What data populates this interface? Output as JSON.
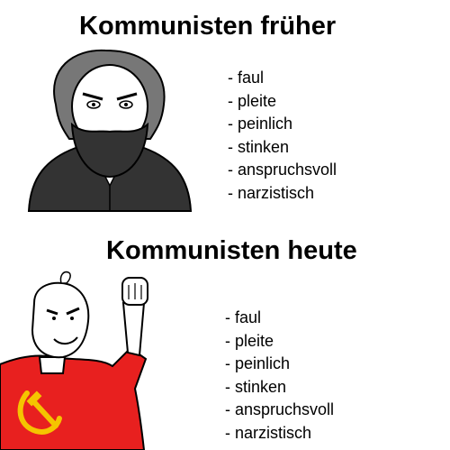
{
  "top_panel": {
    "title": "Kommunisten früher",
    "items": [
      "- faul",
      "- pleite",
      "- peinlich",
      "- stinken",
      "- anspruchsvoll",
      "- narzistisch"
    ]
  },
  "bottom_panel": {
    "title": "Kommunisten heute",
    "items": [
      "- faul",
      "- pleite",
      "- peinlich",
      "- stinken",
      "- anspruchsvoll",
      "- narzistisch"
    ]
  },
  "colors": {
    "background": "#ffffff",
    "text": "#000000",
    "shirt_red": "#e8201f",
    "hammer_sickle": "#f5c400"
  },
  "icons": {
    "top_illustration": "marx-wojak-icon",
    "bottom_illustration": "communist-wojak-icon"
  }
}
